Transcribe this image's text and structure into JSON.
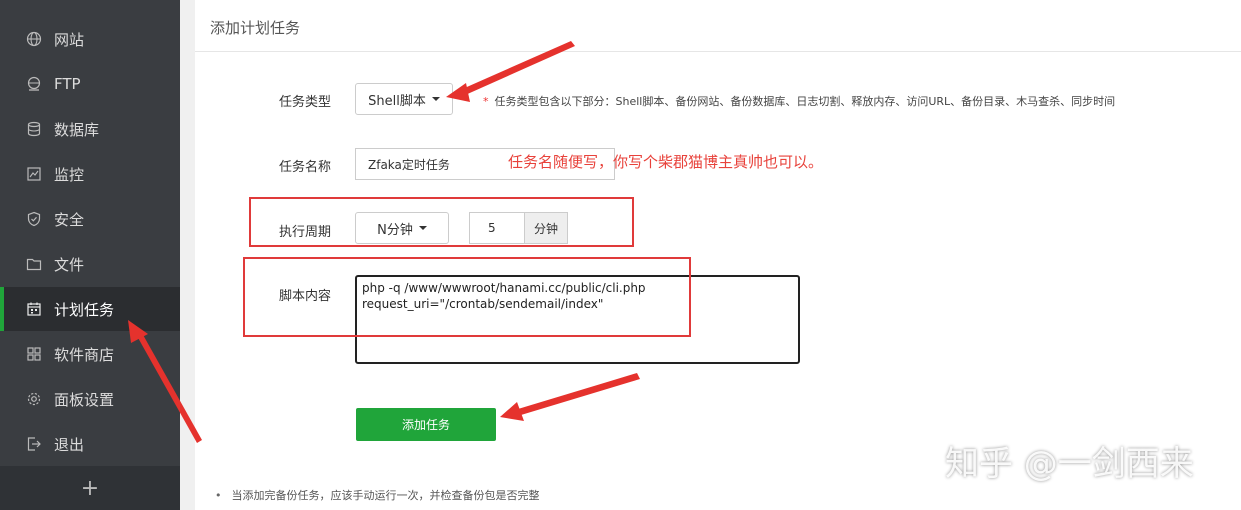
{
  "sidebar": {
    "items": [
      {
        "label": "网站",
        "icon": "globe-icon"
      },
      {
        "label": "FTP",
        "icon": "ftp-icon"
      },
      {
        "label": "数据库",
        "icon": "database-icon"
      },
      {
        "label": "监控",
        "icon": "monitor-icon"
      },
      {
        "label": "安全",
        "icon": "shield-icon"
      },
      {
        "label": "文件",
        "icon": "folder-icon"
      },
      {
        "label": "计划任务",
        "icon": "calendar-icon",
        "active": true
      },
      {
        "label": "软件商店",
        "icon": "grid-icon"
      },
      {
        "label": "面板设置",
        "icon": "gear-icon"
      },
      {
        "label": "退出",
        "icon": "logout-icon"
      }
    ],
    "add_label": "+"
  },
  "panel": {
    "title": "添加计划任务",
    "task_type": {
      "label": "任务类型",
      "value": "Shell脚本",
      "hint": "任务类型包含以下部分：Shell脚本、备份网站、备份数据库、日志切割、释放内存、访问URL、备份目录、木马查杀、同步时间"
    },
    "task_name": {
      "label": "任务名称",
      "value": "Zfaka定时任务"
    },
    "cycle": {
      "label": "执行周期",
      "value": "N分钟",
      "number": "5",
      "unit": "分钟"
    },
    "script": {
      "label": "脚本内容",
      "lines": [
        "php -q /www/wwwroot/hanami.cc/public/cli.php",
        "request_uri=\"/crontab/sendemail/index\""
      ]
    },
    "submit_label": "添加任务",
    "note": "当添加完备份任务，应该手动运行一次，并检查备份包是否完整"
  },
  "annotation": "任务名随便写，你写个柴郡猫博主真帅也可以。",
  "watermark": "知乎 @一剑西来",
  "colors": {
    "sidebar_bg": "#3a3d41",
    "accent_green": "#20a53a",
    "annotation_red": "#e8423b"
  }
}
